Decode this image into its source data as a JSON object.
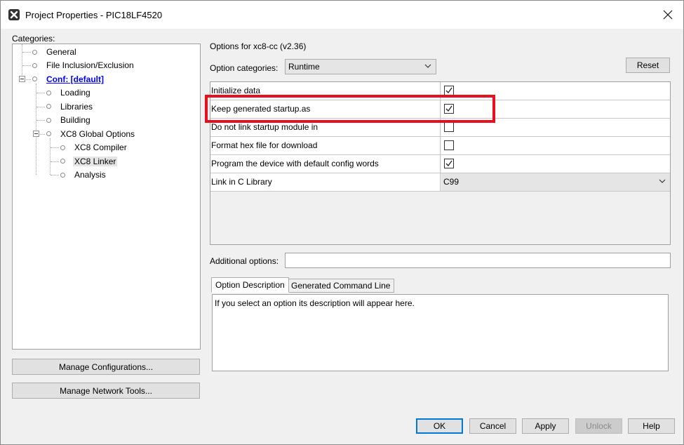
{
  "window": {
    "title": "Project Properties - PIC18LF4520"
  },
  "categories": {
    "label": "Categories:",
    "items": [
      {
        "label": "General"
      },
      {
        "label": "File Inclusion/Exclusion"
      },
      {
        "label": "Conf: [default]"
      },
      {
        "label": "Loading"
      },
      {
        "label": "Libraries"
      },
      {
        "label": "Building"
      },
      {
        "label": "XC8 Global Options"
      },
      {
        "label": "XC8 Compiler"
      },
      {
        "label": "XC8 Linker"
      },
      {
        "label": "Analysis"
      }
    ],
    "manage_configurations": "Manage Configurations...",
    "manage_network_tools": "Manage Network Tools..."
  },
  "options": {
    "header": "Options for xc8-cc (v2.36)",
    "categories_label": "Option categories:",
    "categories_value": "Runtime",
    "reset_label": "Reset",
    "rows": [
      {
        "name": "Initialize data",
        "checked": true
      },
      {
        "name": "Keep generated startup.as",
        "checked": true
      },
      {
        "name": "Do not link startup module in",
        "checked": false
      },
      {
        "name": "Format hex file for download",
        "checked": false
      },
      {
        "name": "Program the device with default config words",
        "checked": true
      },
      {
        "name": "Link in C Library",
        "value": "C99"
      }
    ],
    "additional_label": "Additional options:",
    "additional_value": ""
  },
  "tabs": {
    "description": "Option Description",
    "command_line": "Generated Command Line",
    "description_text": "If you select an option its description will appear here."
  },
  "buttons": {
    "ok": "OK",
    "cancel": "Cancel",
    "apply": "Apply",
    "unlock": "Unlock",
    "help": "Help"
  },
  "colors": {
    "highlight": "#e8101e",
    "link": "#0000ff",
    "default_button_border": "#0078d7"
  }
}
